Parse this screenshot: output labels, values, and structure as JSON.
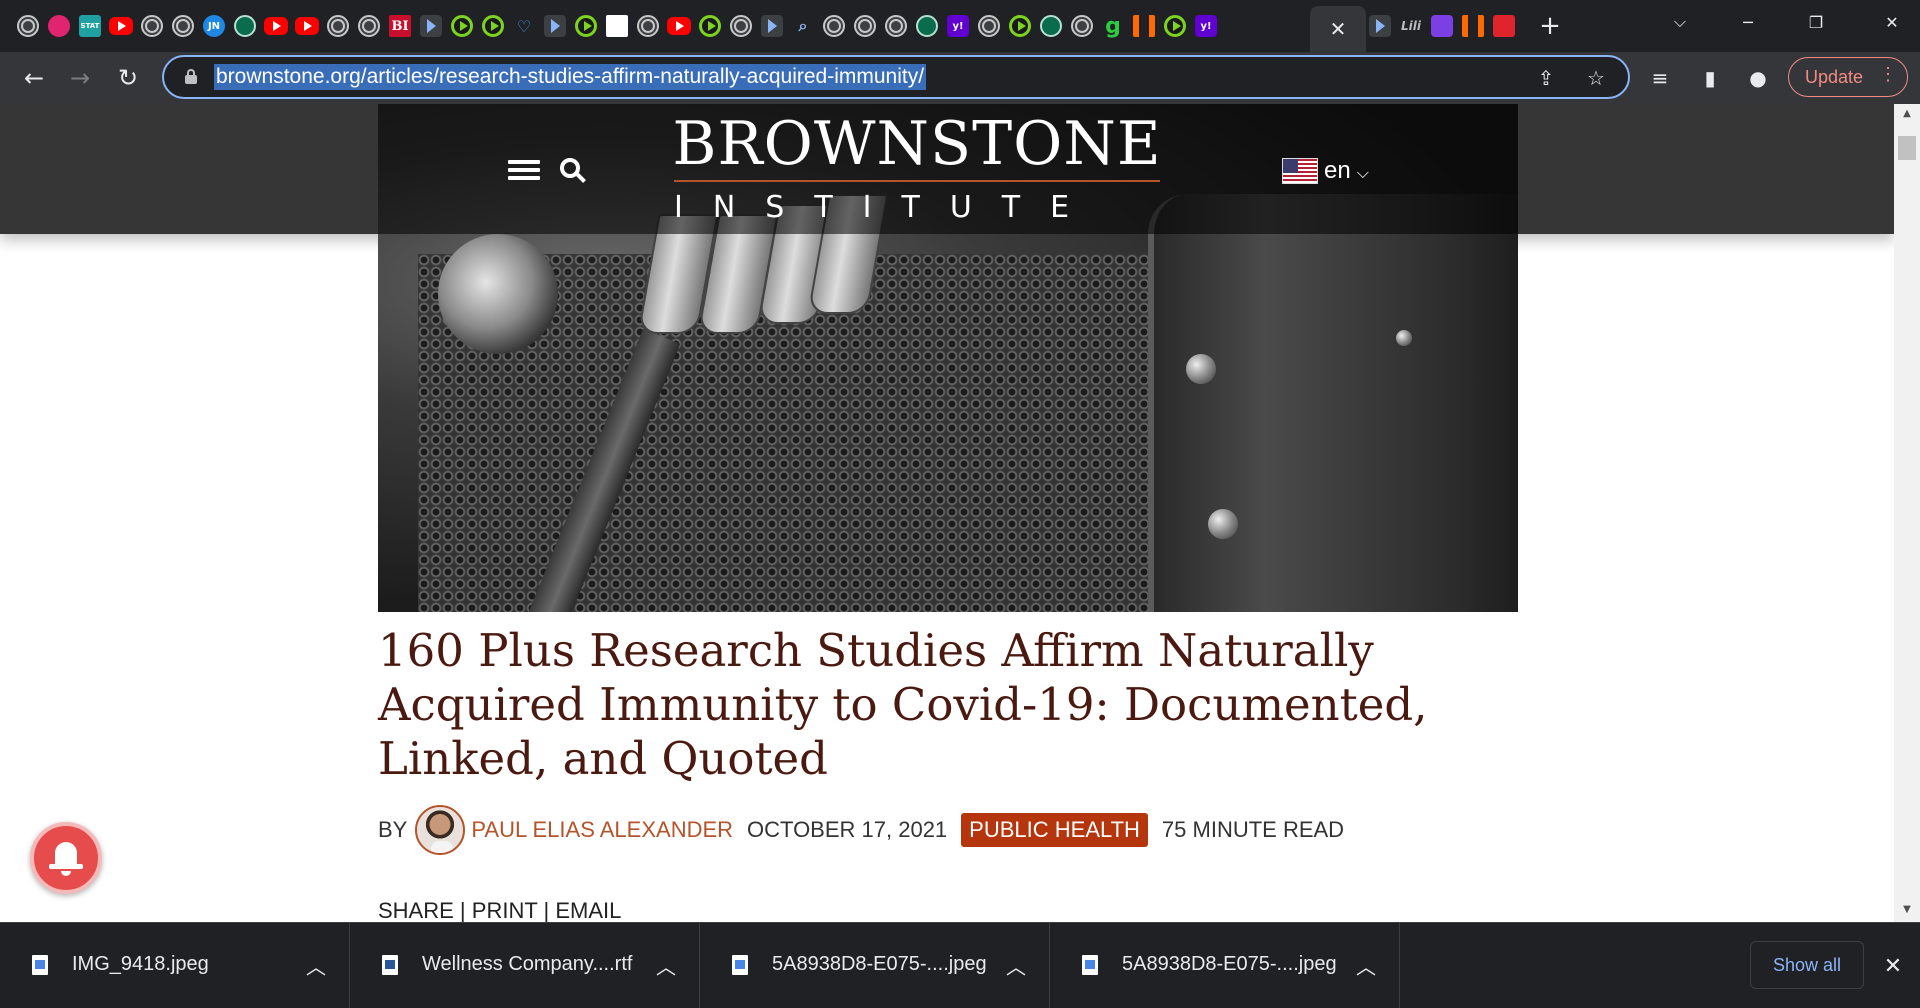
{
  "browser": {
    "url": "brownstone.org/articles/research-studies-affirm-naturally-acquired-immunity/",
    "update_label": "Update",
    "tab_favicons": [
      "globe-icon",
      "pink-flower-icon",
      "stat-icon",
      "youtube-icon",
      "globe-icon",
      "globe-icon",
      "jn-icon",
      "green-icon",
      "youtube-icon",
      "youtube-icon",
      "globe-icon",
      "globe-icon",
      "bi-icon",
      "arrow-icon",
      "play-icon",
      "play-icon",
      "heart-icon",
      "arrow-icon",
      "play-icon",
      "map-icon",
      "globe-icon",
      "youtube-icon",
      "play-icon",
      "globe-icon",
      "arrow-icon",
      "search-icon",
      "globe-icon",
      "globe-icon",
      "globe-icon",
      "green-icon",
      "yahoo-icon",
      "globe-icon",
      "play-icon",
      "green-icon",
      "globe-icon",
      "g-icon",
      "orange-icon",
      "play-icon",
      "yahoo-icon"
    ],
    "favicon_labels": {
      "stat": "STAT",
      "jn": "JN",
      "bi": "BI",
      "yahoo": "y!",
      "g": "g"
    },
    "after_active_favicons": [
      "arrow-icon",
      "lili-icon",
      "purple-icon",
      "orange-icon",
      "red-icon"
    ],
    "after_active_labels": {
      "lili": "Lili"
    }
  },
  "site": {
    "logo_top": "BROWNSTONE",
    "logo_bottom": "INSTITUTE",
    "language": "en",
    "accent_color": "#b5542a"
  },
  "article": {
    "title": "160 Plus Research Studies Affirm Naturally Acquired Immunity to Covid-19: Documented, Linked, and Quoted",
    "by_label": "BY",
    "author": "PAUL ELIAS ALEXANDER",
    "date": "OCTOBER 17, 2021",
    "category": "PUBLIC HEALTH",
    "read_time": "75 MINUTE READ",
    "share_links": [
      "SHARE",
      "PRINT",
      "EMAIL"
    ],
    "share_separator": "|"
  },
  "downloads": {
    "items": [
      {
        "name": "IMG_9418.jpeg",
        "type": "image"
      },
      {
        "name": "Wellness Company....rtf",
        "type": "word"
      },
      {
        "name": "5A8938D8-E075-....jpeg",
        "type": "image"
      },
      {
        "name": "5A8938D8-E075-....jpeg",
        "type": "image"
      }
    ],
    "show_all_label": "Show all"
  }
}
